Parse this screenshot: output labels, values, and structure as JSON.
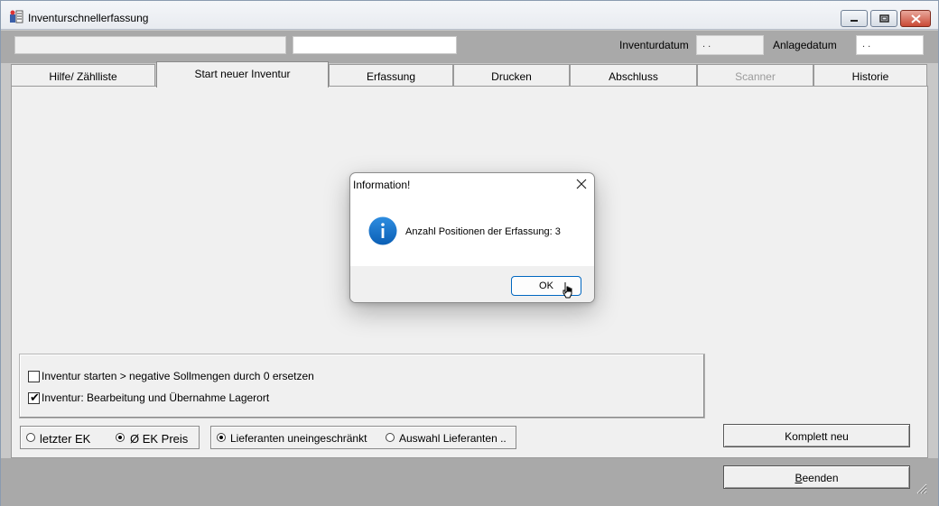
{
  "window": {
    "title": "Inventurschnellerfassung",
    "icon": "app-inventory-icon",
    "controls": [
      "minimize-icon",
      "maximize-icon",
      "close-icon"
    ]
  },
  "header": {
    "field1_value": "",
    "field2_value": "",
    "inventurdatum_label": "Inventurdatum",
    "inventurdatum_value": ". .",
    "anlagedatum_label": "Anlagedatum",
    "anlagedatum_value": ". ."
  },
  "tabs": [
    {
      "label": "Hilfe/ Zählliste",
      "active": false,
      "disabled": false
    },
    {
      "label": "Start neuer Inventur",
      "active": true,
      "disabled": false
    },
    {
      "label": "Erfassung",
      "active": false,
      "disabled": false
    },
    {
      "label": "Drucken",
      "active": false,
      "disabled": false
    },
    {
      "label": "Abschluss",
      "active": false,
      "disabled": false
    },
    {
      "label": "Scanner",
      "active": false,
      "disabled": true
    },
    {
      "label": "Historie",
      "active": false,
      "disabled": false
    }
  ],
  "options": {
    "opt1_label": "Inventur starten > negative Sollmengen durch 0 ersetzen",
    "opt1_checked": false,
    "opt2_label": "Inventur: Bearbeitung und Übernahme Lagerort",
    "opt2_checked": true
  },
  "price_group": {
    "letzter_ek": "letzter EK",
    "ek_preis": "Ø EK Preis",
    "selected": "ek_preis"
  },
  "supplier_group": {
    "uneingeschraenkt": "Lieferanten uneingeschränkt",
    "auswahl": "Auswahl Lieferanten ..",
    "selected": "uneingeschraenkt"
  },
  "buttons": {
    "komplett_neu": "Komplett neu",
    "beenden_prefix": "",
    "beenden_underline": "B",
    "beenden_rest": "eenden"
  },
  "dialog": {
    "title": "Information!",
    "message": "Anzahl Positionen der Erfassung: 3",
    "ok_label": "OK",
    "icon": "info-icon",
    "accent_color": "#0067c0"
  }
}
